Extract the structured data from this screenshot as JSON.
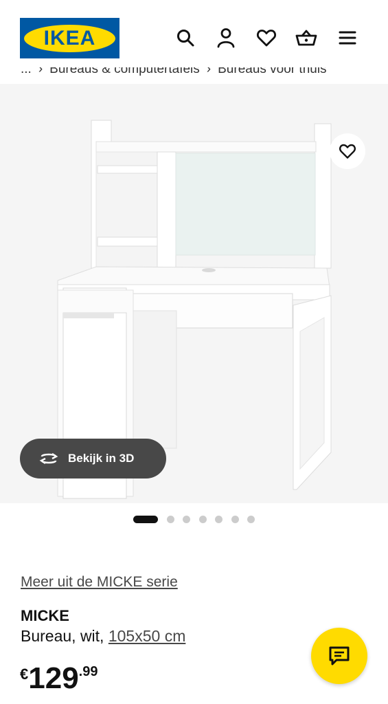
{
  "header": {
    "logo_text": "IKEA",
    "icons": [
      "search-icon",
      "account-icon",
      "heart-icon",
      "basket-icon",
      "menu-icon"
    ]
  },
  "breadcrumb": {
    "ellipsis": "...",
    "items": [
      "Bureaus & computertafels",
      "Bureaus voor thuis"
    ]
  },
  "gallery": {
    "image": "white MICKE desk with shelving unit",
    "favourite_icon": "heart-icon",
    "view3d_label": "Bekijk in 3D",
    "view3d_icon": "rotate-3d-icon",
    "image_count": 7,
    "active_index": 0
  },
  "product": {
    "series_link": "Meer uit de MICKE serie",
    "name": "MICKE",
    "description_prefix": "Bureau, wit, ",
    "size_link": "105x50 cm",
    "price_currency": "€",
    "price_integer": "129",
    "price_decimal": ".99"
  },
  "chat": {
    "icon": "chat-icon"
  },
  "colors": {
    "brand_blue": "#0058a3",
    "brand_yellow": "#ffdb00",
    "pill_bg": "#484848"
  }
}
